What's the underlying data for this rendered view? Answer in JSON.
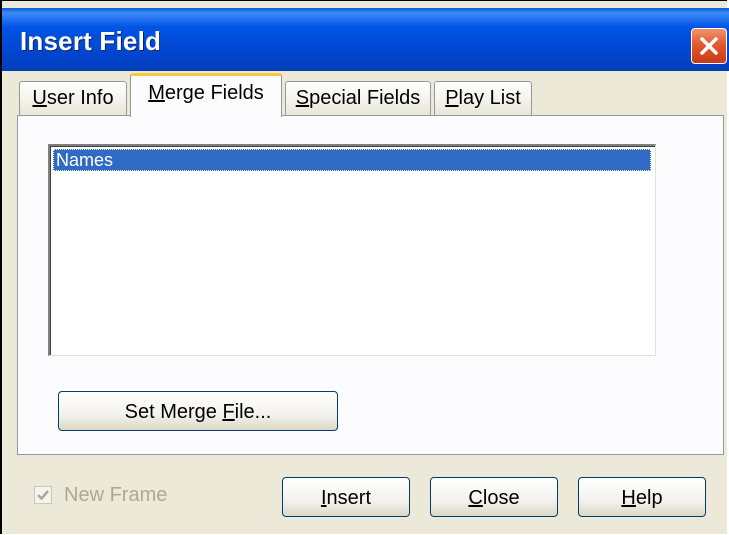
{
  "window": {
    "title": "Insert Field"
  },
  "tabs": [
    {
      "label_pre": "",
      "label_mnemonic": "U",
      "label_post": "ser Info",
      "active": false
    },
    {
      "label_pre": "",
      "label_mnemonic": "M",
      "label_post": "erge Fields",
      "active": true
    },
    {
      "label_pre": "",
      "label_mnemonic": "S",
      "label_post": "pecial Fields",
      "active": false
    },
    {
      "label_pre": "",
      "label_mnemonic": "P",
      "label_post": "lay List",
      "active": false
    }
  ],
  "merge_fields": {
    "items": [
      "Names"
    ],
    "selected_index": 0,
    "set_merge_file": {
      "pre": "Set Merge ",
      "mnemonic": "F",
      "post": "ile..."
    }
  },
  "footer": {
    "new_frame": {
      "label": "New Frame",
      "checked": true,
      "enabled": false
    },
    "insert": {
      "pre": "",
      "mnemonic": "I",
      "post": "nsert"
    },
    "close": {
      "pre": "",
      "mnemonic": "C",
      "post": "lose"
    },
    "help": {
      "pre": "",
      "mnemonic": "H",
      "post": "elp"
    }
  },
  "icons": {
    "close": "close-x-icon",
    "check": "checkmark-icon"
  },
  "colors": {
    "titlebar": "#0055e5",
    "selection": "#316ac5",
    "active_tab_highlight": "#ffc83c",
    "close_button": "#e35a2e"
  }
}
